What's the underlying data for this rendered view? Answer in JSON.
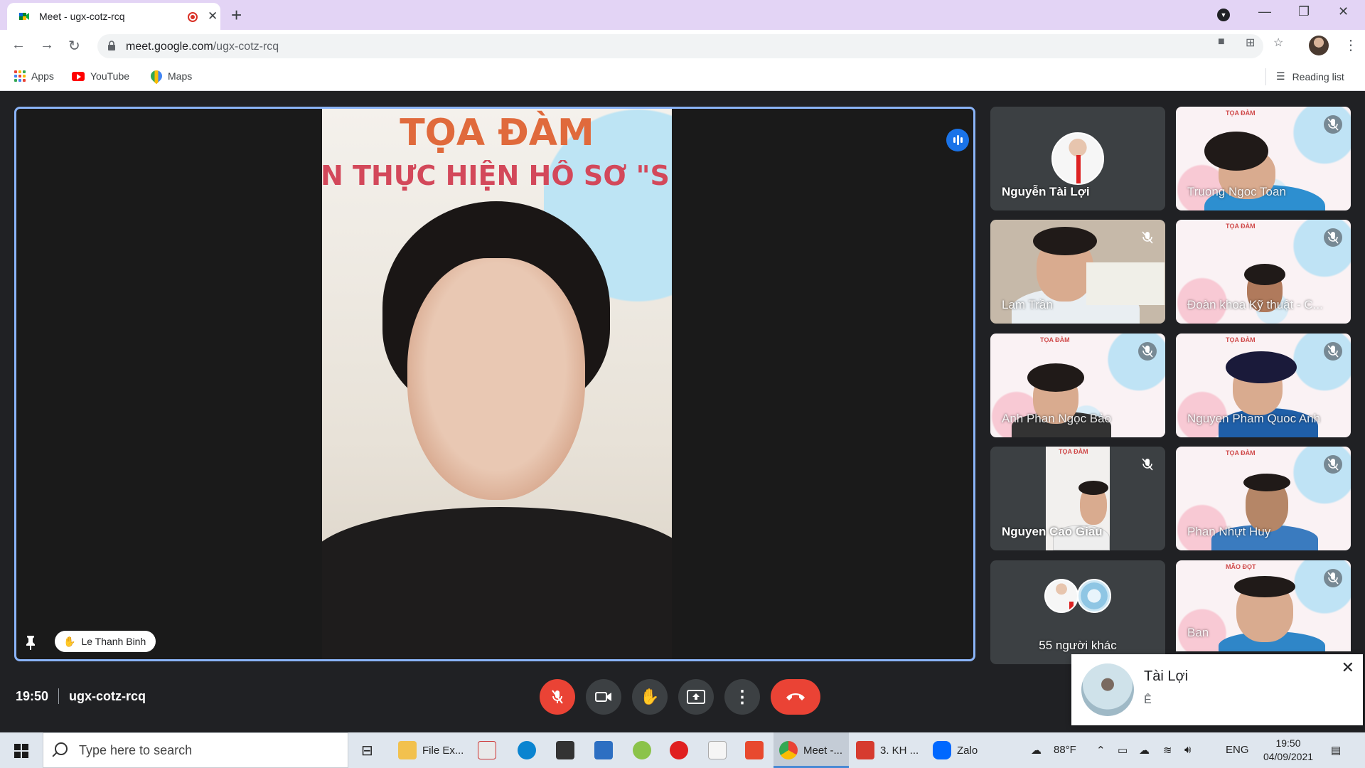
{
  "browser": {
    "tab_title": "Meet - ugx-cotz-rcq",
    "url_host": "meet.google.com",
    "url_path": "/ugx-cotz-rcq",
    "bookmarks": [
      "Apps",
      "YouTube",
      "Maps"
    ],
    "reading_list": "Reading list"
  },
  "main_speaker": {
    "name": "Le Thanh Binh",
    "banner_title": "TỌA ĐÀM",
    "banner_subtitle": "N THỰC HIỆN HỒ SƠ \"SINH V"
  },
  "participants": [
    {
      "name": "Nguyễn Tài Lợi",
      "muted": false
    },
    {
      "name": "Truong Ngoc Toan",
      "muted": true
    },
    {
      "name": "Lam Trần",
      "muted": true
    },
    {
      "name": "Đoàn khoa Kỹ thuật - C...",
      "muted": true
    },
    {
      "name": "Anh Phan Ngọc Bảo",
      "muted": true
    },
    {
      "name": "Nguyen Pham Quoc Anh",
      "muted": true
    },
    {
      "name": "Nguyen Cao Giau",
      "muted": true
    },
    {
      "name": "Phan Nhựt Huy",
      "muted": true
    },
    {
      "name": "55 người khác",
      "muted": false
    },
    {
      "name": "Ban",
      "muted": true
    }
  ],
  "meeting": {
    "time": "19:50",
    "code": "ugx-cotz-rcq"
  },
  "notification": {
    "sender": "Tài Lợi",
    "message": "Ê"
  },
  "taskbar": {
    "search_placeholder": "Type here to search",
    "apps": [
      "File Ex...",
      "Meet -...",
      "3. KH ...",
      "Zalo"
    ],
    "weather": "88°F",
    "language": "ENG",
    "clock_time": "19:50",
    "clock_date": "04/09/2021"
  },
  "colors": {
    "meet_bg": "#202124",
    "active_border": "#8ab4f8",
    "leave_red": "#ea4335",
    "tab_strip": "#e3d4f5"
  }
}
